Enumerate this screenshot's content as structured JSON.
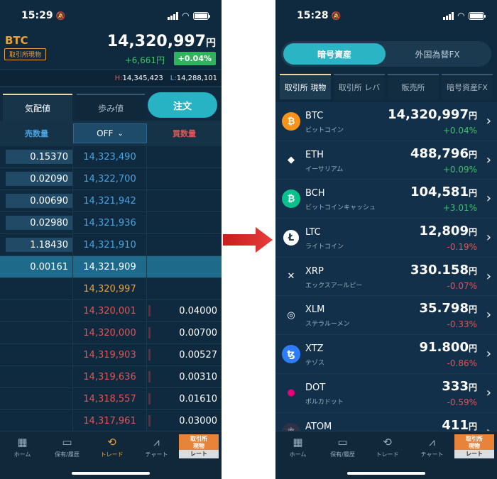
{
  "left": {
    "status": {
      "time": "15:29"
    },
    "header": {
      "symbol": "BTC",
      "badge": "取引所現物",
      "price": "14,320,997",
      "price_unit": "円",
      "change": "+6,661円",
      "change_pct": "+0.04%",
      "high_label": "H:",
      "high": "14,345,423",
      "low_label": "L:",
      "low": "14,288,101"
    },
    "tabs": {
      "kehai": "気配値",
      "ayumi": "歩み値",
      "order": "注文"
    },
    "columns": {
      "sell": "売数量",
      "off": "OFF",
      "buy": "買数量"
    },
    "book": [
      {
        "sell_qty": "0.15370",
        "price": "14,323,490",
        "type": "ask",
        "buy_qty": ""
      },
      {
        "sell_qty": "0.02090",
        "price": "14,322,700",
        "type": "ask",
        "buy_qty": ""
      },
      {
        "sell_qty": "0.00690",
        "price": "14,321,942",
        "type": "ask",
        "buy_qty": ""
      },
      {
        "sell_qty": "0.02980",
        "price": "14,321,936",
        "type": "ask",
        "buy_qty": ""
      },
      {
        "sell_qty": "1.18430",
        "price": "14,321,910",
        "type": "ask",
        "buy_qty": ""
      },
      {
        "sell_qty": "0.00161",
        "price": "14,321,909",
        "type": "ask-hl",
        "buy_qty": ""
      },
      {
        "sell_qty": "",
        "price": "14,320,997",
        "type": "cur",
        "buy_qty": ""
      },
      {
        "sell_qty": "",
        "price": "14,320,001",
        "type": "bid",
        "buy_qty": "0.04000"
      },
      {
        "sell_qty": "",
        "price": "14,320,000",
        "type": "bid",
        "buy_qty": "0.00700"
      },
      {
        "sell_qty": "",
        "price": "14,319,903",
        "type": "bid",
        "buy_qty": "0.00527"
      },
      {
        "sell_qty": "",
        "price": "14,319,636",
        "type": "bid",
        "buy_qty": "0.00310"
      },
      {
        "sell_qty": "",
        "price": "14,318,557",
        "type": "bid",
        "buy_qty": "0.01610"
      },
      {
        "sell_qty": "",
        "price": "14,317,961",
        "type": "bid",
        "buy_qty": "0.03000"
      }
    ]
  },
  "nav": {
    "home": "ホーム",
    "holdings": "保有/履歴",
    "trade": "トレード",
    "chart": "チャート",
    "rate_top": "取引所\n現物",
    "rate_bottom": "レート"
  },
  "right": {
    "status": {
      "time": "15:28"
    },
    "segment": {
      "crypto": "暗号資産",
      "fx": "外国為替FX"
    },
    "tabs": [
      "取引所 現物",
      "取引所 レバ",
      "販売所",
      "暗号資産FX"
    ],
    "coins": [
      {
        "symbol": "BTC",
        "name": "ビットコイン",
        "price": "14,320,997",
        "unit": "円",
        "change": "+0.04%",
        "dir": "up",
        "icon_color": "#f7931a",
        "glyph": "₿"
      },
      {
        "symbol": "ETH",
        "name": "イーサリアム",
        "price": "488,796",
        "unit": "円",
        "change": "+0.09%",
        "dir": "up",
        "icon_color": "#13304a",
        "glyph": "◆"
      },
      {
        "symbol": "BCH",
        "name": "ビットコインキャッシュ",
        "price": "104,581",
        "unit": "円",
        "change": "+3.01%",
        "dir": "up",
        "icon_color": "#0ac18e",
        "glyph": "₿"
      },
      {
        "symbol": "LTC",
        "name": "ライトコイン",
        "price": "12,809",
        "unit": "円",
        "change": "-0.19%",
        "dir": "down",
        "icon_color": "#ffffff",
        "glyph": "Ł"
      },
      {
        "symbol": "XRP",
        "name": "エックスアールピー",
        "price": "330.158",
        "unit": "円",
        "change": "-0.07%",
        "dir": "down",
        "icon_color": "#13304a",
        "glyph": "✕"
      },
      {
        "symbol": "XLM",
        "name": "ステラルーメン",
        "price": "35.798",
        "unit": "円",
        "change": "-0.33%",
        "dir": "down",
        "icon_color": "#13304a",
        "glyph": "◎"
      },
      {
        "symbol": "XTZ",
        "name": "テゾス",
        "price": "91.800",
        "unit": "円",
        "change": "-0.86%",
        "dir": "down",
        "icon_color": "#2c7df7",
        "glyph": "ꜩ"
      },
      {
        "symbol": "DOT",
        "name": "ポルカドット",
        "price": "333",
        "unit": "円",
        "change": "-0.59%",
        "dir": "down",
        "icon_color": "#13304a",
        "glyph": "●"
      },
      {
        "symbol": "ATOM",
        "name": "",
        "price": "411",
        "unit": "円",
        "change": "",
        "dir": "down",
        "icon_color": "#2e3148",
        "glyph": "⚛"
      }
    ]
  }
}
